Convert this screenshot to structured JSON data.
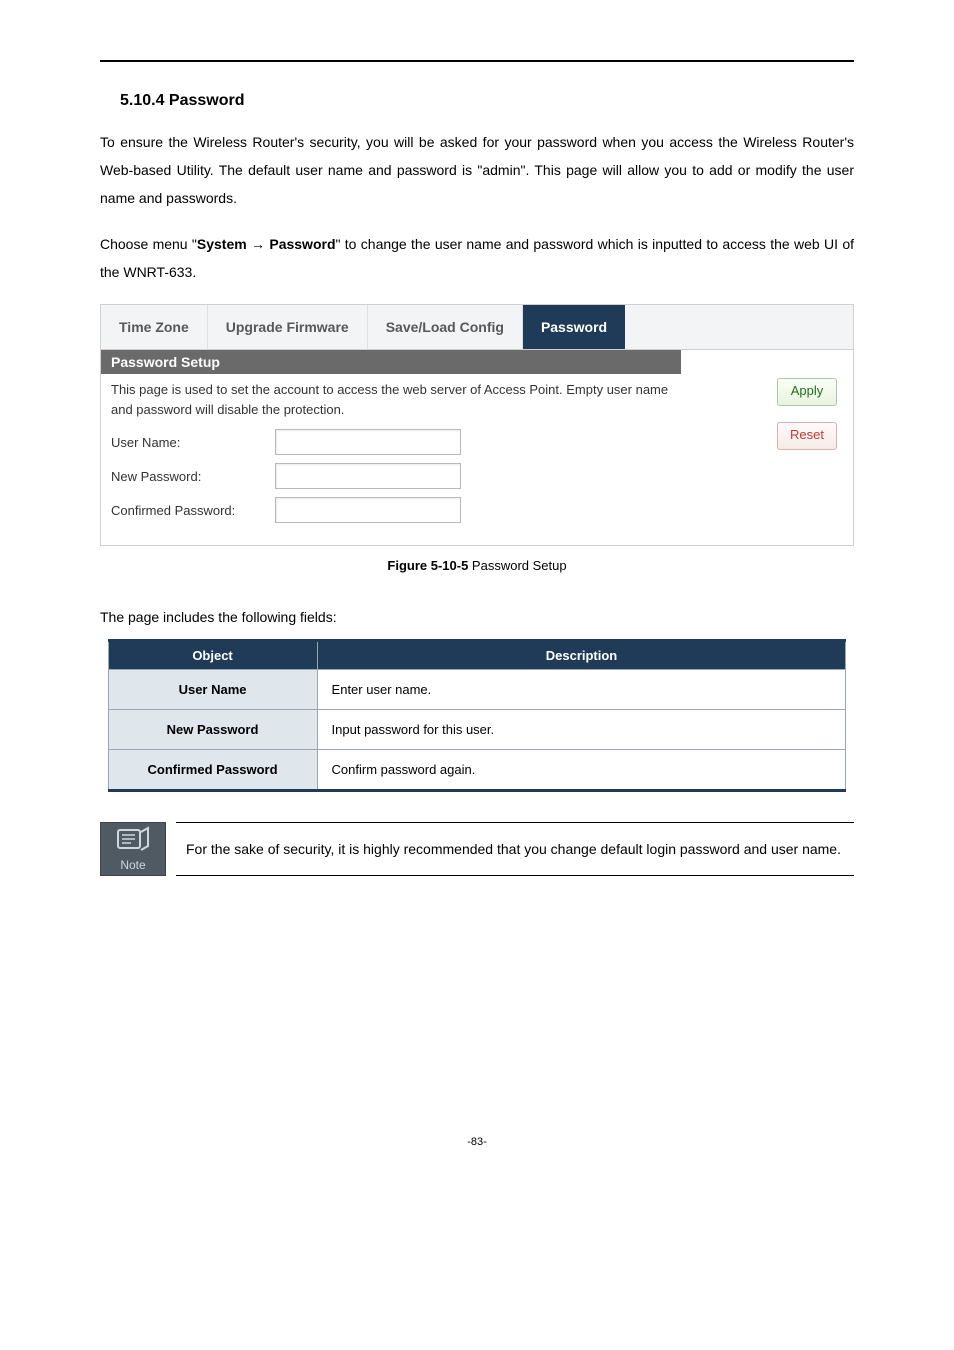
{
  "heading": "5.10.4 Password",
  "para1_a": "To ensure the Wireless Router's security, you will be asked for your password when you access the Wireless Router's Web-based Utility. The default user name and password is \"admin\". This page will allow you to add or modify the user name and passwords.",
  "para2_a": "Choose menu \"",
  "para2_b": "System",
  "para2_arrow": " → ",
  "para2_c": "Password",
  "para2_d": "\" to change the user name and password which is inputted to access the web UI of the WNRT-633.",
  "tabs": {
    "time_zone": "Time Zone",
    "upgrade": "Upgrade Firmware",
    "saveload": "Save/Load Config",
    "password": "Password"
  },
  "panel": {
    "title": "Password Setup",
    "desc": "This page is used to set the account to access the web server of Access Point. Empty user name and password will disable the protection.",
    "user_name_label": "User Name:",
    "new_pw_label": "New Password:",
    "conf_pw_label": "Confirmed Password:",
    "apply": "Apply",
    "reset": "Reset"
  },
  "fig_caption_b": "Figure 5-10-5",
  "fig_caption_rest": " Password Setup",
  "fields_intro": "The page includes the following fields:",
  "fields_table": {
    "head_obj": "Object",
    "head_desc": "Description",
    "rows": [
      {
        "obj": "User Name",
        "desc": "Enter user name."
      },
      {
        "obj": "New Password",
        "desc": "Input password for this user."
      },
      {
        "obj": "Confirmed Password",
        "desc": "Confirm password again."
      }
    ]
  },
  "note_label": "Note",
  "note_text": "For the sake of security, it is highly recommended that you change default login password and user name.",
  "page_num": "-83-"
}
